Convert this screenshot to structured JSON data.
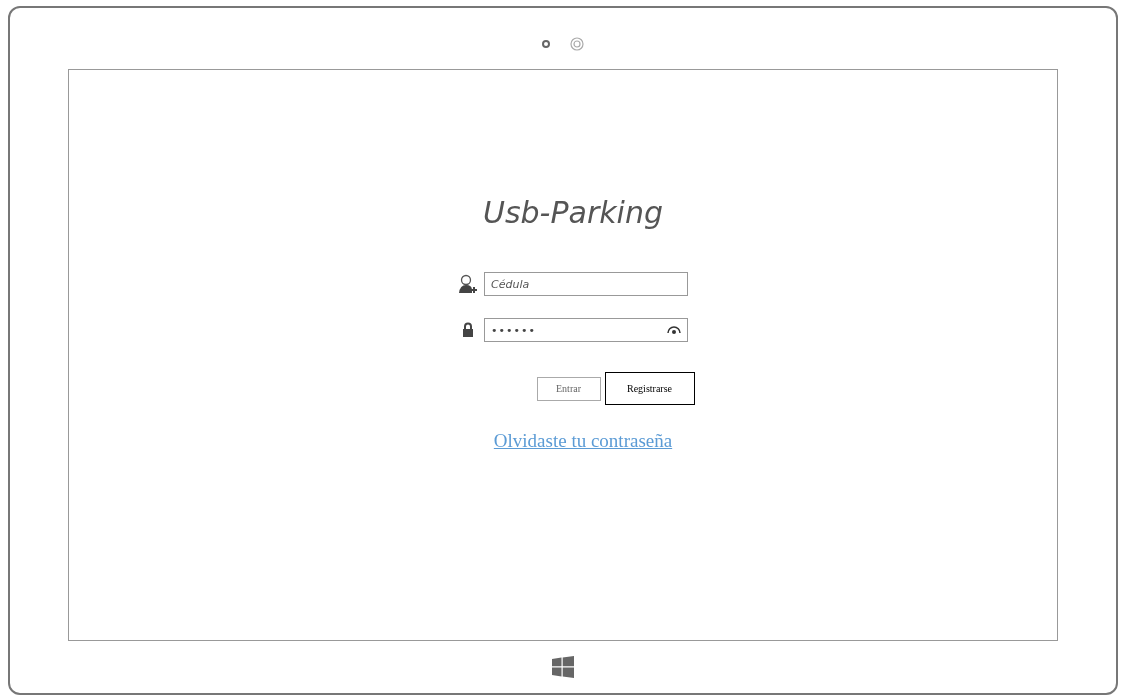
{
  "app": {
    "title": "Usb-Parking"
  },
  "fields": [
    {
      "kind": "user",
      "placeholder": "Cédula"
    },
    {
      "kind": "password",
      "value": "••••••"
    }
  ],
  "buttons": [
    {
      "label": "Entrar",
      "kind": "sketch"
    },
    {
      "label": "Registrarse",
      "kind": "plain"
    }
  ],
  "link": "Olvidaste tu contraseña"
}
